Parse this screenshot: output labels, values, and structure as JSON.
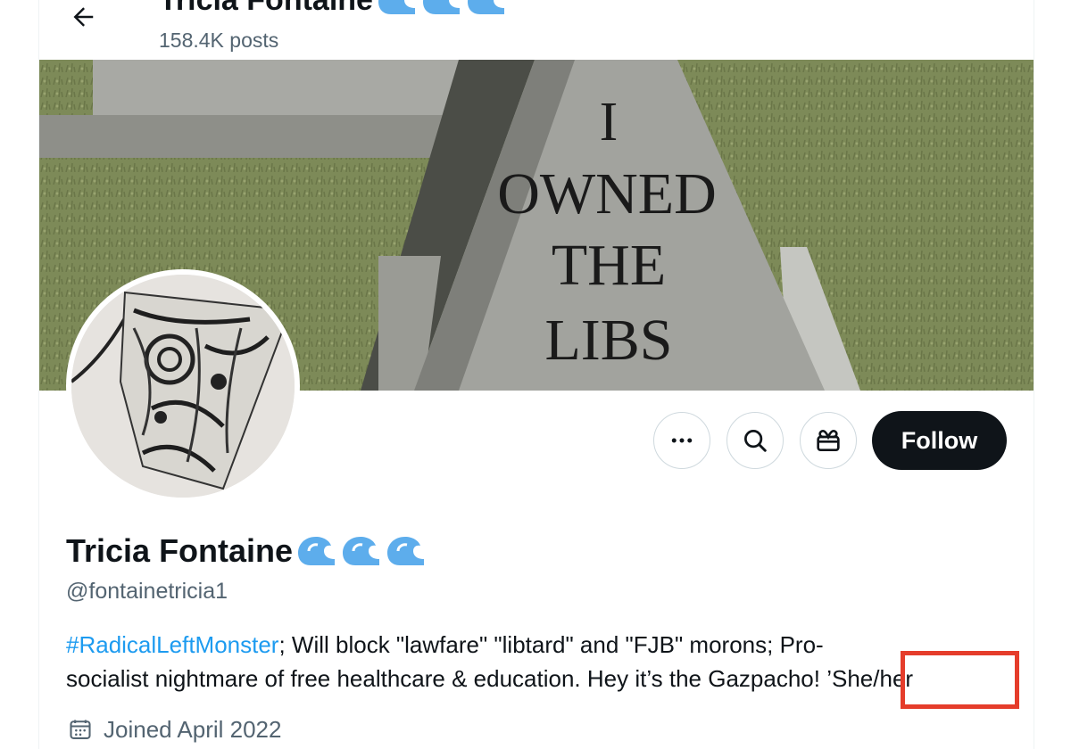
{
  "header": {
    "title": "Tricia Fontaine",
    "posts_count": "158.4K posts",
    "back_icon": "arrow-left-icon"
  },
  "banner": {
    "text_line1": "I",
    "text_line2": "OWNED",
    "text_line3": "THE",
    "text_line4": "LIBS"
  },
  "actions": {
    "more_icon": "more-icon",
    "search_icon": "search-icon",
    "gift_icon": "gift-icon",
    "follow_label": "Follow"
  },
  "profile": {
    "display_name": "Tricia Fontaine",
    "name_emoji_icon": "wave-emoji-icon",
    "handle": "@fontainetricia1",
    "bio": {
      "hashtag": "#RadicalLeftMonster",
      "line1_rest": "; Will block \"lawfare\" \"libtard\" and \"FJB\" morons;  Pro-",
      "line2": "socialist nightmare of free healthcare & education. Hey it’s the Gazpacho! ",
      "pronouns": "’She/her"
    },
    "joined": "Joined April 2022"
  },
  "colors": {
    "accent_link": "#1d9bf0",
    "follow_bg": "#0f1419",
    "secondary_text": "#536471",
    "highlight_border": "#e53d2b",
    "wave_emoji": "#5dadec"
  }
}
